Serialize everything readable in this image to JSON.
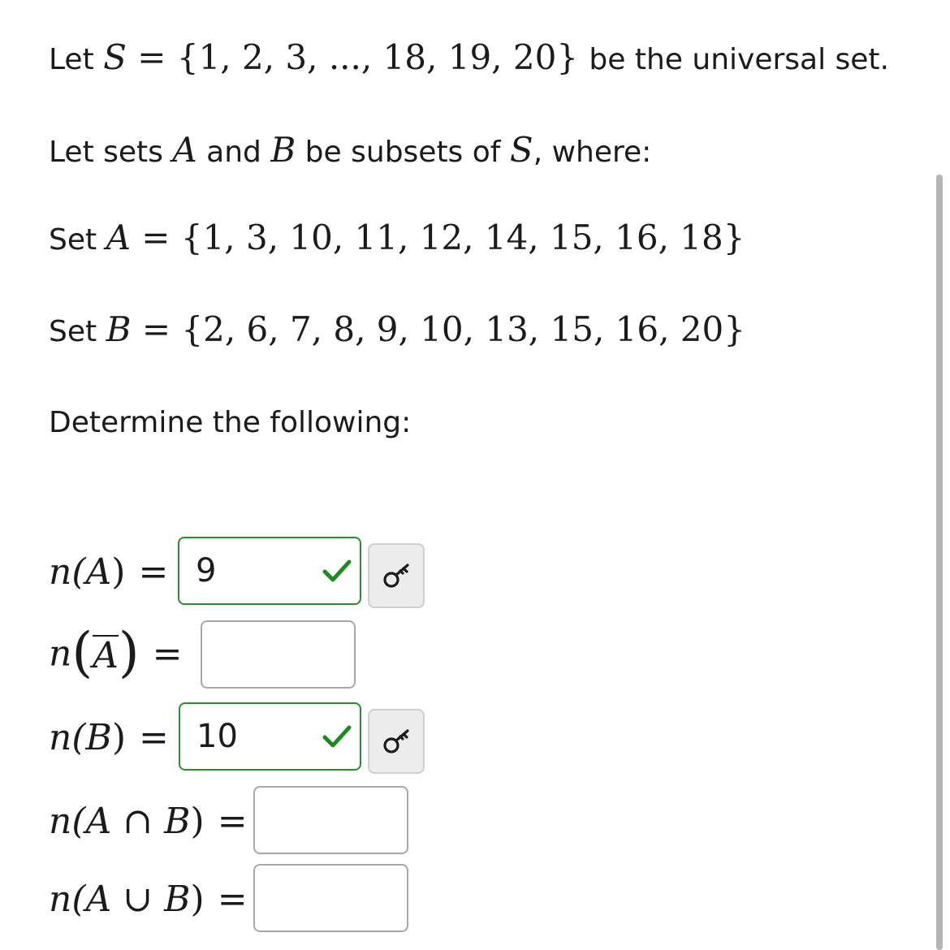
{
  "question": {
    "line1": {
      "prefix": "Let",
      "set_name": "S",
      "eq": "=",
      "set_value": "{1, 2, 3, ..., 18, 19, 20}",
      "suffix": "be the universal set."
    },
    "line2": {
      "part1": "Let sets",
      "set_a": "A",
      "part2": "and",
      "set_b": "B",
      "part3": "be subsets of",
      "set_s": "S",
      "part4": ", where:"
    },
    "set_a": {
      "prefix": "Set",
      "name": "A",
      "eq": "=",
      "value": "{1, 3, 10, 11, 12, 14, 15, 16, 18}"
    },
    "set_b": {
      "prefix": "Set",
      "name": "B",
      "eq": "=",
      "value": "{2, 6, 7, 8, 9, 10, 13, 15, 16, 20}"
    },
    "instruction": "Determine the following:"
  },
  "answers": {
    "n_a": {
      "fn": "n(",
      "arg": "A",
      "close": ")",
      "eq": "=",
      "value": "9",
      "status": "correct"
    },
    "n_a_complement": {
      "fn": "n",
      "open": "(",
      "arg": "A",
      "close": ")",
      "eq": "=",
      "value": ""
    },
    "n_b": {
      "fn": "n(",
      "arg": "B",
      "close": ")",
      "eq": "=",
      "value": "10",
      "status": "correct"
    },
    "n_a_intersect_b": {
      "fn": "n(",
      "arg1": "A",
      "op": "∩",
      "arg2": "B",
      "close": ")",
      "eq": "=",
      "value": ""
    },
    "n_a_union_b": {
      "fn": "n(",
      "arg1": "A",
      "op": "∪",
      "arg2": "B",
      "close": ")",
      "eq": "=",
      "value": ""
    }
  },
  "icons": {
    "correct": "checkmark-icon",
    "answer_key": "key-icon"
  },
  "colors": {
    "correct_border": "#2e8b2e",
    "correct_check": "#1f8a1f",
    "empty_border": "#a8a8a8",
    "key_button_bg": "#ececec",
    "scrollbar": "#b5b5b5"
  }
}
